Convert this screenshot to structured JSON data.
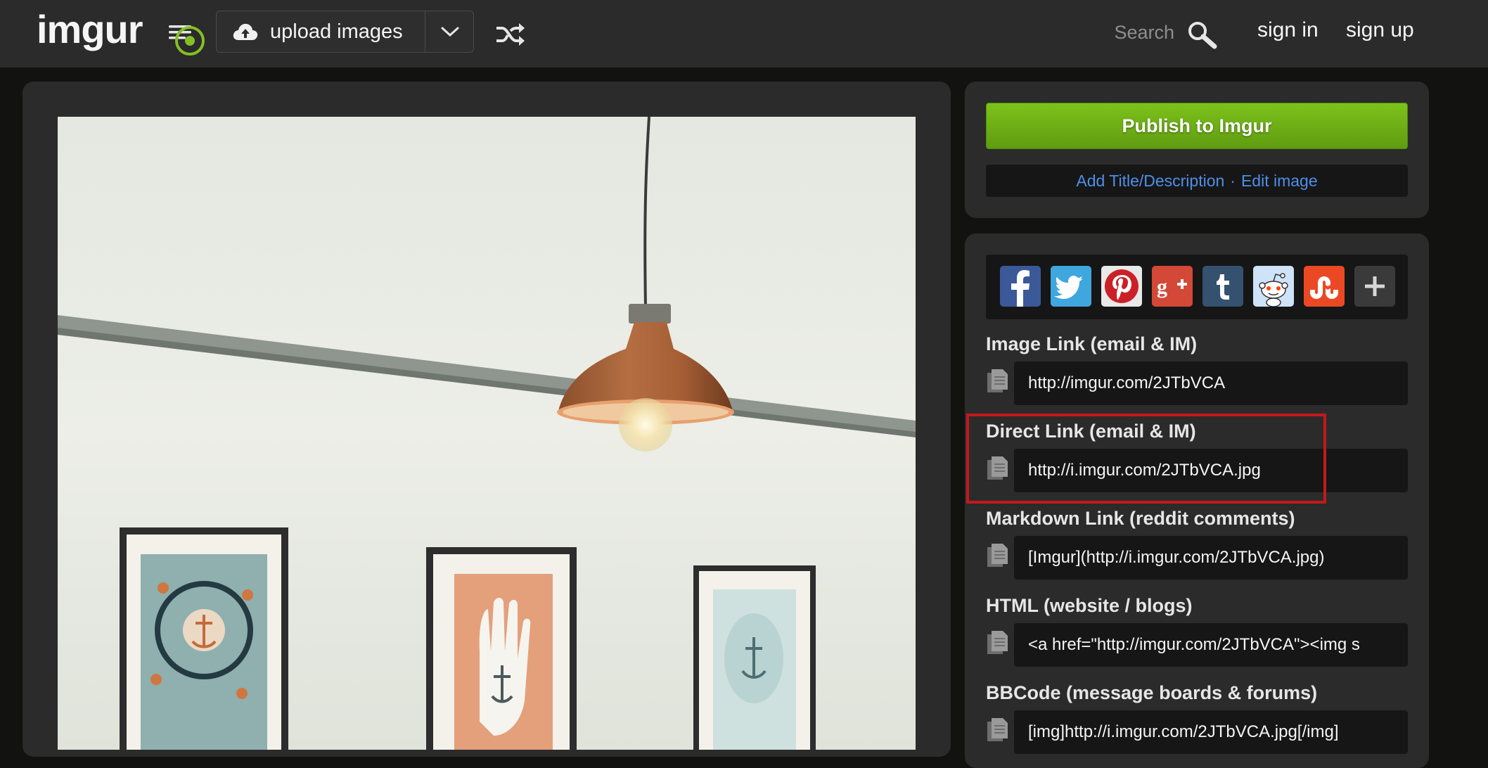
{
  "header": {
    "logo_text": "imgur",
    "upload_label": "upload images",
    "search_placeholder": "Search",
    "sign_in": "sign in",
    "sign_up": "sign up"
  },
  "publish": {
    "button_label": "Publish to Imgur",
    "add_title_link": "Add Title/Description",
    "separator": "·",
    "edit_link": "Edit image"
  },
  "share": {
    "social_icons": [
      "facebook-icon",
      "twitter-icon",
      "pinterest-icon",
      "google-plus-icon",
      "tumblr-icon",
      "reddit-icon",
      "stumbleupon-icon",
      "more-icon"
    ],
    "fields": [
      {
        "label": "Image Link (email & IM)",
        "value": "http://imgur.com/2JTbVCA"
      },
      {
        "label": "Direct Link (email & IM)",
        "value": "http://i.imgur.com/2JTbVCA.jpg"
      },
      {
        "label": "Markdown Link (reddit comments)",
        "value": "[Imgur](http://i.imgur.com/2JTbVCA.jpg)"
      },
      {
        "label": "HTML (website / blogs)",
        "value": "<a href=\"http://imgur.com/2JTbVCA\"><img s"
      },
      {
        "label": "BBCode (message boards & forums)",
        "value": "[img]http://i.imgur.com/2JTbVCA.jpg[/img]"
      }
    ]
  },
  "colors": {
    "brand_green": "#85bf25",
    "link_blue": "#4e8fe8",
    "highlight_red": "#c4191b",
    "panel_bg": "#2b2b2b"
  }
}
